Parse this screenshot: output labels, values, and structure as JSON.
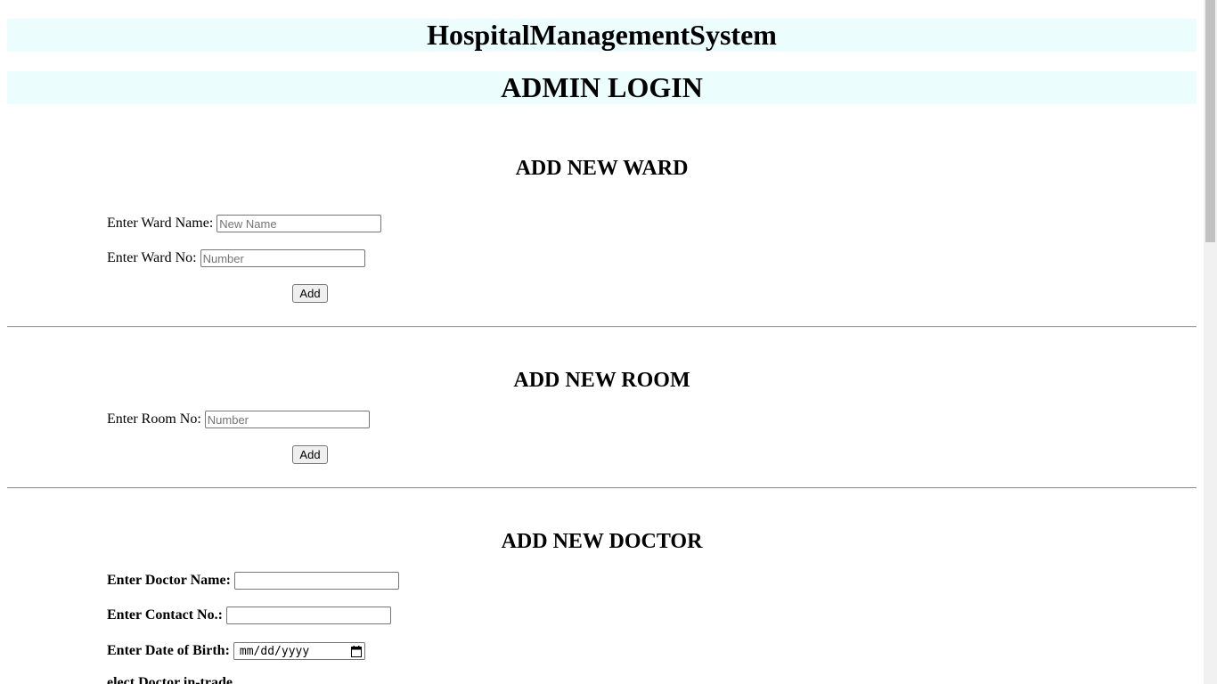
{
  "header": {
    "app_title": "HospitalManagementSystem",
    "page_title": "ADMIN LOGIN"
  },
  "ward_section": {
    "heading": "ADD NEW WARD",
    "name_label": "Enter Ward Name:",
    "name_placeholder": "New Name",
    "number_label": "Enter Ward No:",
    "number_placeholder": "Number",
    "add_label": "Add"
  },
  "room_section": {
    "heading": "ADD NEW ROOM",
    "number_label": "Enter Room No:",
    "number_placeholder": "Number",
    "add_label": "Add"
  },
  "doctor_section": {
    "heading": "ADD NEW DOCTOR",
    "name_label": "Enter Doctor Name:",
    "contact_label": "Enter Contact No.:",
    "dob_label": "Enter Date of Birth:",
    "dob_placeholder": "mm/dd/yyyy",
    "cut_off_label": "elect Doctor in-trade"
  },
  "colors": {
    "banner_bg": "#ebfdfd",
    "rule": "#9a9a9a",
    "button_bg": "#efefef"
  },
  "icons": {
    "date_picker": "calendar-icon"
  }
}
